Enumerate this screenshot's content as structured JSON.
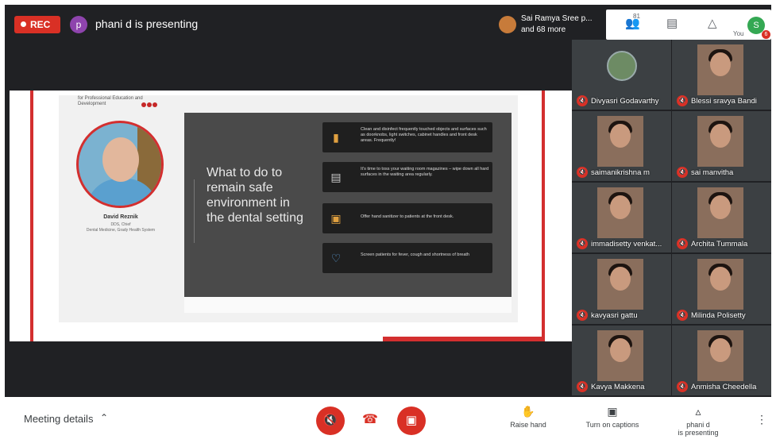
{
  "topbar": {
    "rec_label": "REC",
    "presenter_initial": "p",
    "presenting_title": "phani d is presenting",
    "people_line1": "Sai Ramya Sree p...",
    "people_line2": "and 68 more",
    "people_count": "81",
    "you_label": "You",
    "you_initial": "S",
    "notification_count": "6",
    "icons": [
      "people-icon",
      "chat-icon",
      "activities-icon"
    ]
  },
  "slide": {
    "logo_text": "for Professional Education and Development",
    "speaker_name": "David Reznik",
    "speaker_title": "DDS, Chief",
    "speaker_org": "Dental Medicine, Grady Health System",
    "headline": "What to do to remain safe environment in the dental setting",
    "tips": [
      {
        "icon": "spray-icon",
        "text": "Clean and disinfect frequently touched objects and surfaces such as doorknobs, light switches, cabinet handles and front desk areas. Frequently!"
      },
      {
        "icon": "magazine-icon",
        "text": "It's time to toss your waiting room magazines – wipe down all hard surfaces in the waiting area regularly."
      },
      {
        "icon": "sanitizer-icon",
        "text": "Offer hand sanitizer to patients at the front desk."
      },
      {
        "icon": "heart-icon",
        "text": "Screen patients for fever, cough and shortness of breath"
      }
    ]
  },
  "participants": [
    {
      "name": "Divyasri Godavarthy",
      "video": false
    },
    {
      "name": "Blessi sravya Bandi",
      "video": true
    },
    {
      "name": "saimanikrishna m",
      "video": true
    },
    {
      "name": "sai manvitha",
      "video": true
    },
    {
      "name": "immadisetty venkat...",
      "video": true
    },
    {
      "name": "Archita Tummala",
      "video": true
    },
    {
      "name": "kavyasri gattu",
      "video": true
    },
    {
      "name": "Milinda Polisetty",
      "video": true
    },
    {
      "name": "Kavya Makkena",
      "video": true
    },
    {
      "name": "Anmisha Cheedella",
      "video": true
    }
  ],
  "bottombar": {
    "meeting_details": "Meeting details",
    "raise_hand": "Raise hand",
    "captions": "Turn on captions",
    "presenting_line1": "phani d",
    "presenting_line2": "is presenting"
  },
  "colors": {
    "rec_red": "#d93025",
    "slide_accent": "#d32f2f",
    "tip_icon": "#e0a040",
    "background": "#202124"
  }
}
